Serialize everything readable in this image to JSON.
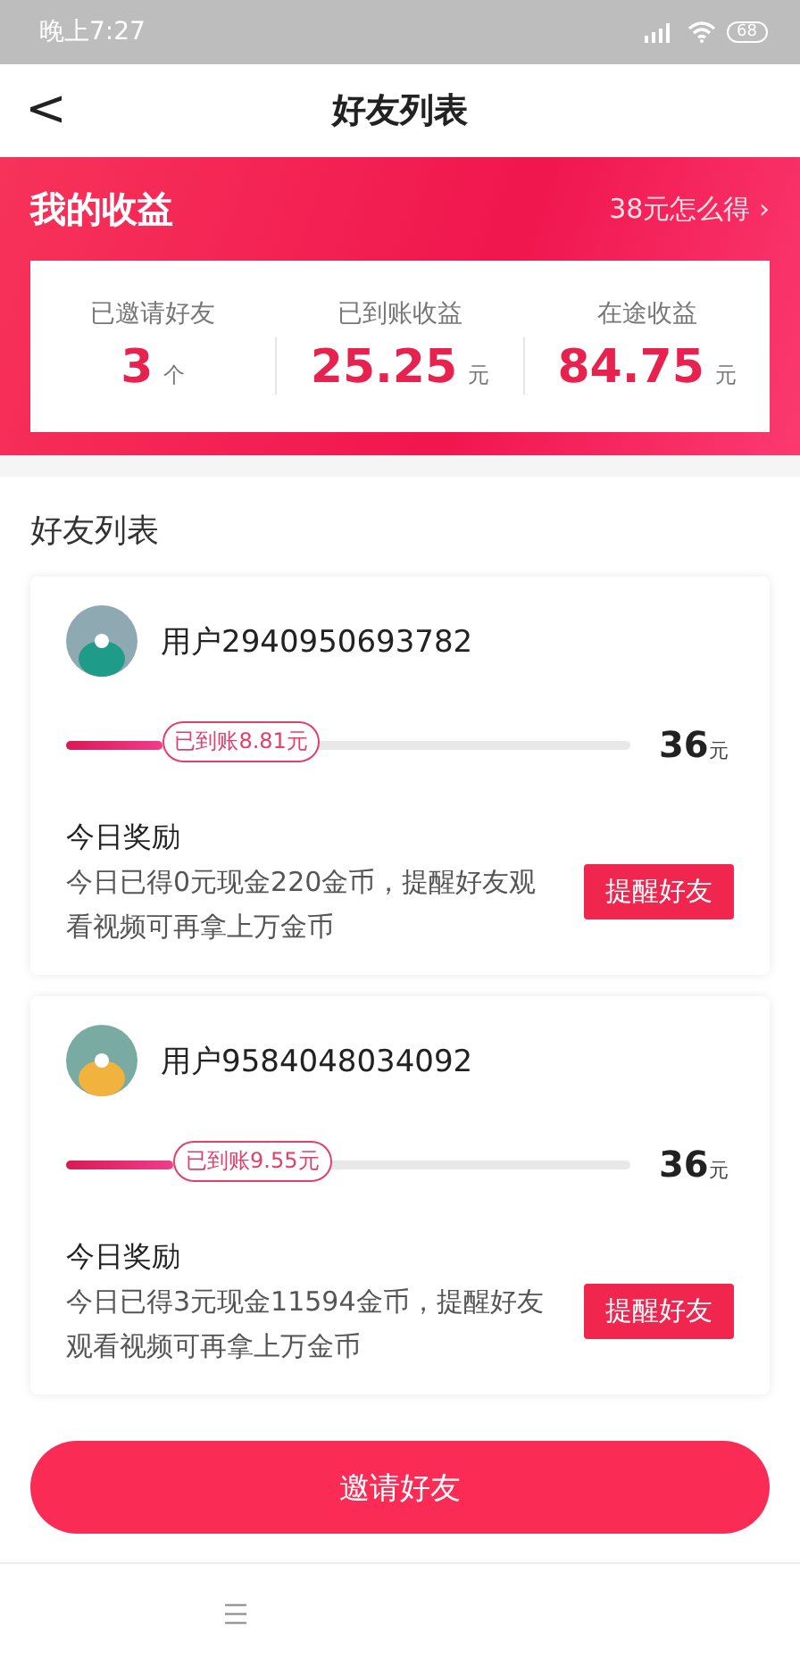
{
  "status_bar": {
    "time": "晚上7:27",
    "battery": "68"
  },
  "nav": {
    "back": "<",
    "title": "好友列表"
  },
  "earnings": {
    "title": "我的收益",
    "link": "38元怎么得",
    "link_arrow": "›",
    "stats": [
      {
        "label": "已邀请好友",
        "value": "3",
        "unit": "个"
      },
      {
        "label": "已到账收益",
        "value": "25.25",
        "unit": "元"
      },
      {
        "label": "在途收益",
        "value": "84.75",
        "unit": "元"
      }
    ]
  },
  "friends": {
    "title": "好友列表",
    "items": [
      {
        "name": "用户2940950693782",
        "kind": "teal",
        "level": 0.17,
        "badge": "已到账8.81元",
        "target": "36",
        "target_unit": "元",
        "reward_title": "今日奖励",
        "reward_text": "今日已得0元现金220金币，提醒好友观看视频可再拿上万金币",
        "button": "提醒好友"
      },
      {
        "name": "用户9584048034092",
        "kind": "yellow",
        "level": 0.19,
        "badge": "已到账9.55元",
        "target": "36",
        "target_unit": "元",
        "reward_title": "今日奖励",
        "reward_text": "今日已得3元现金11594金币，提醒好友观看视频可再拿上万金币",
        "button": "提醒好友"
      }
    ]
  },
  "invite_button": "邀请好友"
}
